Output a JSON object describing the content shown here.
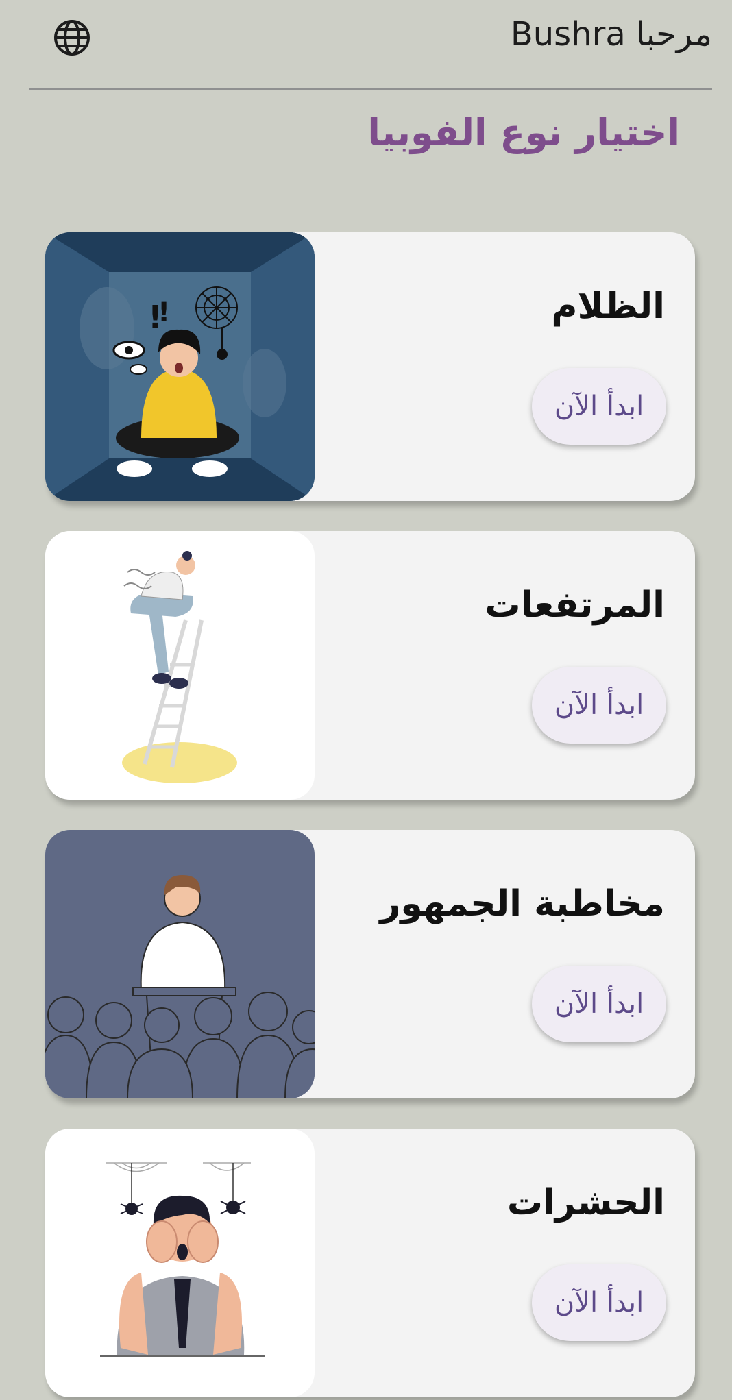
{
  "header": {
    "greeting": "مرحبا Bushra",
    "language_icon": "globe-icon"
  },
  "page": {
    "title": "اختيار نوع الفوبيا"
  },
  "colors": {
    "background": "#cdcfc6",
    "title": "#7e4d8c",
    "button_text": "#5d4a8a",
    "card": "#f3f3f3"
  },
  "phobias": [
    {
      "title": "الظلام",
      "button": "ابدأ الآن",
      "illustration": "person-in-dark-room"
    },
    {
      "title": "المرتفعات",
      "button": "ابدأ الآن",
      "illustration": "person-on-ladder"
    },
    {
      "title": "مخاطبة الجمهور",
      "button": "ابدأ الآن",
      "illustration": "speaker-at-podium"
    },
    {
      "title": "الحشرات",
      "button": "ابدأ الآن",
      "illustration": "person-with-spiders"
    }
  ]
}
